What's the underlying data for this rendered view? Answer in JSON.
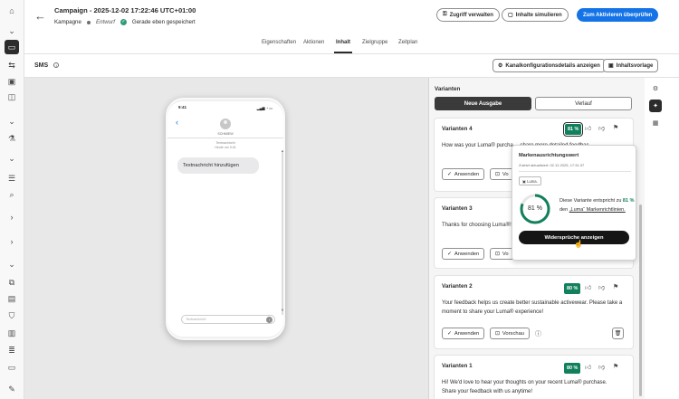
{
  "header": {
    "title": "Campaign - 2025-12-02 17:22:46 UTC+01:00",
    "type_label": "Kampagne",
    "status": "Entwurf",
    "saved_text": "Gerade eben gespeichert",
    "manage_access_label": "Zugriff verwalten",
    "simulate_label": "Inhalte simulieren",
    "review_activate_label": "Zum Aktivieren überprüfen"
  },
  "tabs": [
    "Eigenschaften",
    "Aktionen",
    "Inhalt",
    "Zielgruppe",
    "Zeitplan"
  ],
  "active_tab": "Inhalt",
  "channel": {
    "title": "SMS",
    "config_details_label": "Kanalkonfigurationsdetails anzeigen",
    "content_template_label": "Inhaltsvorlage"
  },
  "phone": {
    "time": "9:41",
    "contact_name": "SCHMIEW",
    "meta1": "Textnachricht",
    "meta2": "Heute um 9:41",
    "message": "Textnachricht hinzufügen",
    "input_placeholder": "Textnachricht"
  },
  "variants_panel": {
    "title": "Varianten",
    "new_output_label": "Neue Ausgabe",
    "history_label": "Verlauf",
    "apply_label": "Anwenden",
    "preview_label": "Vorschau",
    "cards": [
      {
        "title": "Varianten 4",
        "score": "81 %",
        "text": "How was your Luma® purcha… share more detailed feedbac…"
      },
      {
        "title": "Varianten 3",
        "score": "",
        "text": "Thanks for choosing Luma®! H… exclusive rewards. Share your…"
      },
      {
        "title": "Varianten 2",
        "score": "80 %",
        "text": "Your feedback helps us create better sustainable activewear. Please take a moment to share your Luma® experience!"
      },
      {
        "title": "Varianten 1",
        "score": "80 %",
        "text": "Hi! We'd love to hear your thoughts on your recent Luma® purchase. Share your feedback with us anytime!"
      }
    ]
  },
  "popover": {
    "heading": "Markenausrichtungswert",
    "updated": "Zuletzt aktualisiert: 02.12.2025, 17:31:37",
    "brand": "Luma.",
    "score_text": "81 %",
    "score_value": 81,
    "desc_prefix": "Diese Variante entspricht zu",
    "desc_pct": "81 %",
    "desc_mid": "den",
    "desc_link": "„Luma“ Markenrichtlinien.",
    "button_label": "Widersprüche anzeigen"
  },
  "colors": {
    "accent": "#1473e6",
    "score_green": "#12805c",
    "dark_button": "#151515"
  }
}
